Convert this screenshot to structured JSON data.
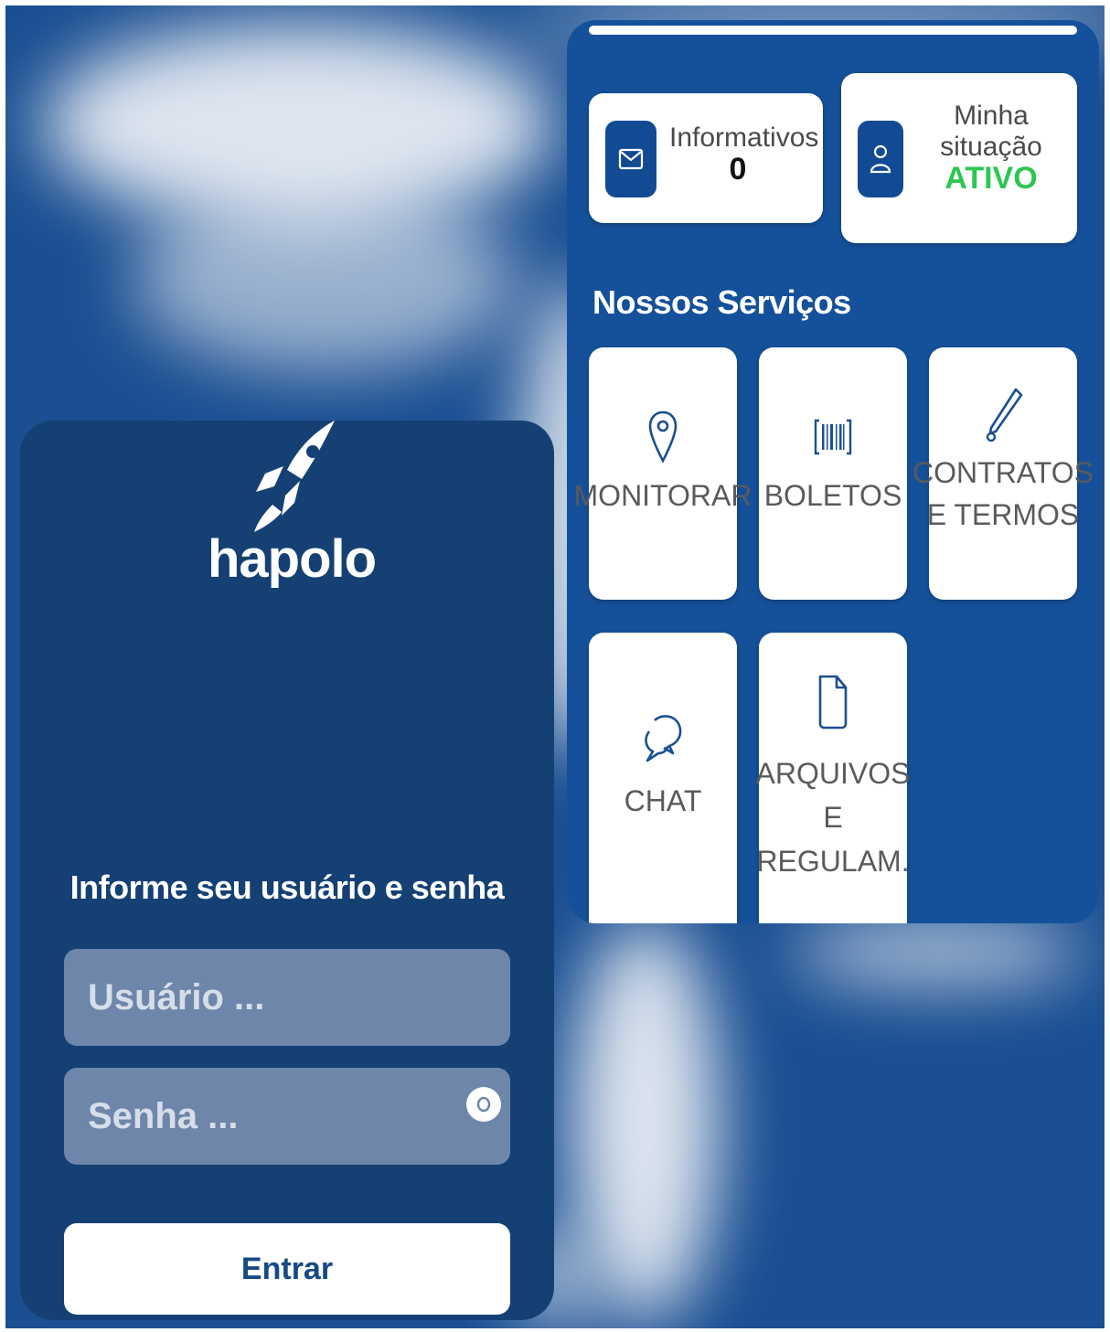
{
  "dashboard": {
    "informativos": {
      "label": "Informativos",
      "count": "0",
      "icon": "mail-icon"
    },
    "situacao": {
      "label_line1": "Minha",
      "label_line2": "situação",
      "status": "ATIVO",
      "status_color": "#2dc653",
      "icon": "user-icon"
    },
    "section_title": "Nossos Serviços",
    "services": [
      {
        "icon": "location-pin-icon",
        "lines": [
          "MONITORAR"
        ]
      },
      {
        "icon": "barcode-icon",
        "lines": [
          "BOLETOS"
        ]
      },
      {
        "icon": "pen-icon",
        "lines": [
          "CONTRATOS",
          "E TERMOS"
        ]
      },
      {
        "icon": "chat-bubbles-icon",
        "lines": [
          "CHAT"
        ]
      },
      {
        "icon": "document-icon",
        "lines": [
          "ARQUIVOS",
          "E",
          "REGULAM."
        ]
      }
    ]
  },
  "login": {
    "brand": "hapolo",
    "logo": "rocket-icon",
    "prompt": "Informe seu usuário e senha",
    "user_placeholder": "Usuário ...",
    "password_placeholder": "Senha ...",
    "toggle_icon": "eye-icon",
    "submit_label": "Entrar"
  },
  "colors": {
    "background": "#1a4f92",
    "dashboard_panel": "#15519a",
    "login_panel": "#144074",
    "icon_box": "#124b93",
    "input": "#6e86a9",
    "button_text": "#174a84"
  }
}
